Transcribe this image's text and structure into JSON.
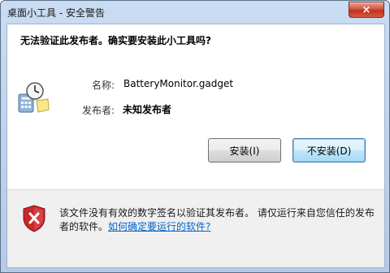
{
  "window": {
    "title": "桌面小工具 - 安全警告",
    "close_label": "×"
  },
  "dialog": {
    "question": "无法验证此发布者。确实要安装此小工具吗?",
    "name_label": "名称:",
    "name_value": "BatteryMonitor.gadget",
    "publisher_label": "发布者:",
    "publisher_value": "未知发布者",
    "install_button": "安装(I)",
    "dont_install_button": "不安装(D)"
  },
  "footer": {
    "warning_text": "该文件没有有效的数字签名以验证其发布者。 请仅运行来自您信任的发布者的软件。",
    "help_link": "如何确定要运行的软件?"
  },
  "icons": {
    "gadget": "gadget-calculator-clock-icon",
    "shield": "security-shield-x-icon"
  },
  "colors": {
    "shield_red": "#c8282b",
    "link": "#0066cc",
    "focus_button_border": "#3c7fb1"
  }
}
